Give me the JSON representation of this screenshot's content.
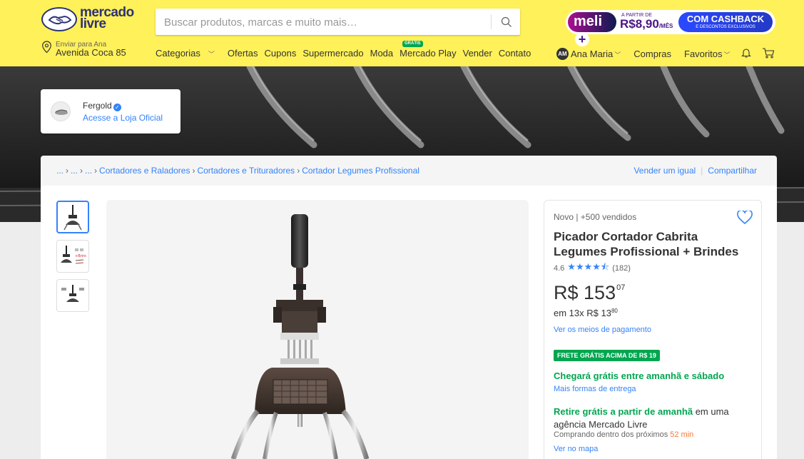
{
  "header": {
    "logo_line1": "mercado",
    "logo_line2": "livre",
    "search_placeholder": "Buscar produtos, marcas e muito mais…",
    "meli_label": "meli",
    "meli_plus": "+",
    "meli_from": "A PARTIR DE",
    "meli_price": "R$8,90",
    "meli_per": "/MÊS",
    "cashback_title": "COM CASHBACK",
    "cashback_sub": "E DESCONTOS EXCLUSIVOS",
    "location_small": "Enviar para Ana",
    "location_address": "Avenida Coca 85",
    "nav": {
      "categorias": "Categorias",
      "ofertas": "Ofertas",
      "cupons": "Cupons",
      "supermercado": "Supermercado",
      "moda": "Moda",
      "mercado_play": "Mercado Play",
      "mercado_play_badge": "GRÁTIS",
      "vender": "Vender",
      "contato": "Contato"
    },
    "user_initials": "AM",
    "user_name": "Ana Maria",
    "compras": "Compras",
    "favoritos": "Favoritos"
  },
  "store": {
    "name": "Fergold",
    "link": "Acesse a Loja Oficial"
  },
  "breadcrumb": {
    "ellipsis1": "...",
    "ellipsis2": "...",
    "ellipsis3": "...",
    "item1": "Cortadores e Raladores",
    "item2": "Cortadores e Trituradores",
    "item3": "Cortador Legumes Profissional",
    "sell_same": "Vender um igual",
    "share": "Compartilhar"
  },
  "product": {
    "condition": "Novo | +500 vendidos",
    "title": "Picador Cortador Cabrita Legumes Profissional + Brindes",
    "rating": "4.6",
    "rating_stars": 4.6,
    "reviews": "(182)",
    "price_currency": "R$",
    "price_int": "153",
    "price_cents": "07",
    "installments": "em 13x R$ 13",
    "installment_cents": "80",
    "payment_link": "Ver os meios de pagamento",
    "free_shipping_badge": "FRETE GRÁTIS ACIMA DE R$ 19",
    "delivery": "Chegará grátis entre amanhã e sábado",
    "delivery_link": "Mais formas de entrega",
    "pickup_bold": "Retire grátis a partir de amanhã",
    "pickup_rest": " em uma agência Mercado Livre",
    "buy_within": "Comprando dentro dos próximos ",
    "buy_within_time": "52 min",
    "map_link": "Ver no mapa"
  },
  "colors": {
    "header_bg": "#fff159",
    "link_blue": "#3483fa",
    "green": "#00a650",
    "orange": "#ff7733"
  }
}
